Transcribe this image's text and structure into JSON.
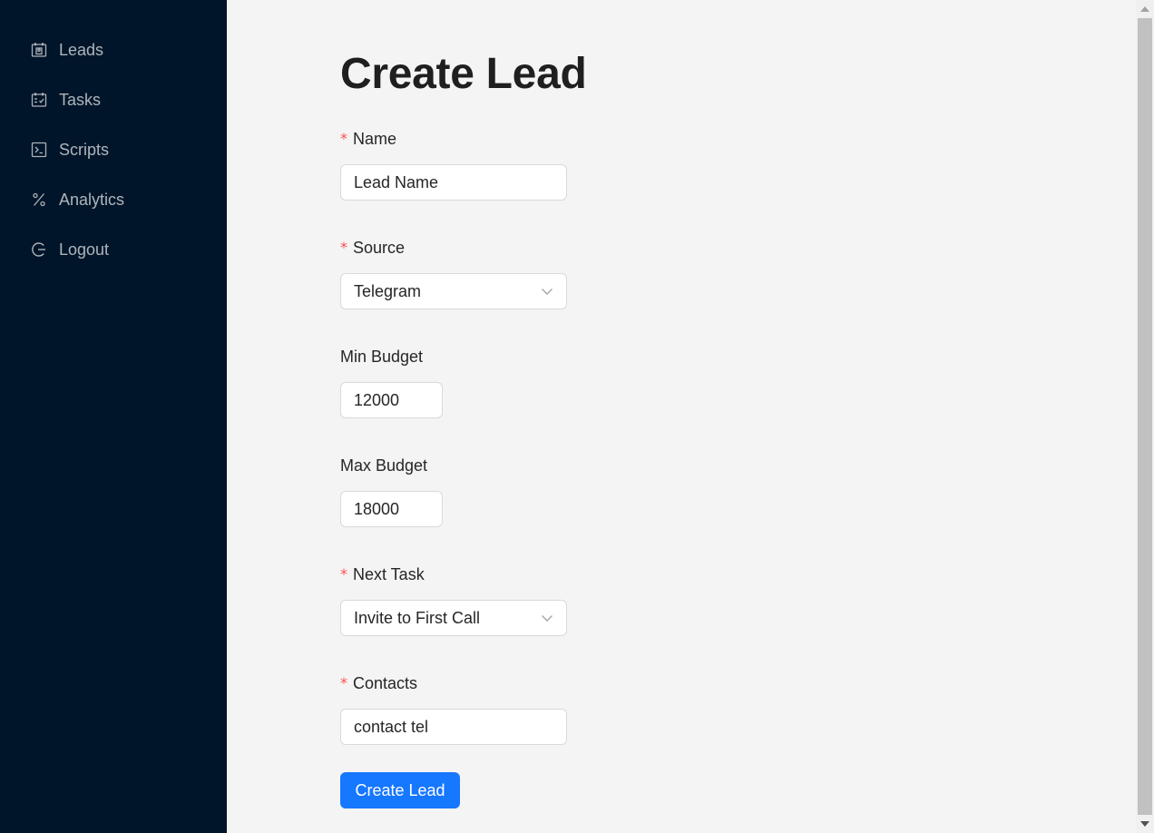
{
  "sidebar": {
    "items": [
      {
        "label": "Leads",
        "icon": "contacts-calendar-icon"
      },
      {
        "label": "Tasks",
        "icon": "schedule-icon"
      },
      {
        "label": "Scripts",
        "icon": "code-terminal-icon"
      },
      {
        "label": "Analytics",
        "icon": "percentage-icon"
      },
      {
        "label": "Logout",
        "icon": "logout-icon"
      }
    ]
  },
  "form": {
    "title": "Create Lead",
    "required_mark": "*",
    "name": {
      "label": "Name",
      "value": "Lead Name"
    },
    "source": {
      "label": "Source",
      "value": "Telegram"
    },
    "min_budget": {
      "label": "Min Budget",
      "value": "12000"
    },
    "max_budget": {
      "label": "Max Budget",
      "value": "18000"
    },
    "next_task": {
      "label": "Next Task",
      "value": "Invite to First Call"
    },
    "contacts": {
      "label": "Contacts",
      "value": "contact tel"
    },
    "submit_label": "Create Lead"
  },
  "colors": {
    "sidebar_bg": "#001529",
    "page_bg": "#f4f4f4",
    "primary": "#1677ff",
    "required": "#ff4d4f"
  }
}
